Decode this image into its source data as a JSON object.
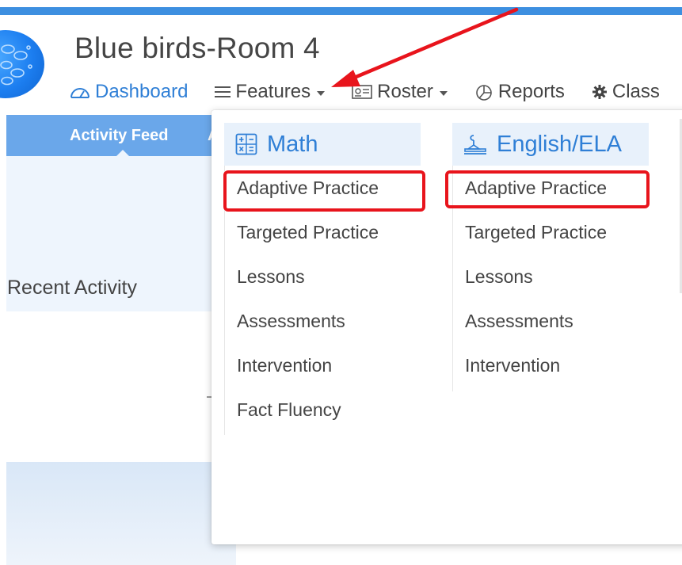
{
  "header": {
    "room_title": "Blue birds-Room 4"
  },
  "nav": {
    "items": [
      {
        "label": "Dashboard",
        "icon": "gauge-icon",
        "active": true
      },
      {
        "label": "Features",
        "icon": "menu-lines-icon",
        "caret": true
      },
      {
        "label": "Roster",
        "icon": "id-card-icon",
        "caret": true
      },
      {
        "label": "Reports",
        "icon": "pie-chart-icon"
      },
      {
        "label": "Class",
        "icon": "gear-icon"
      }
    ]
  },
  "subnav": {
    "active_tab": "Activity Feed",
    "partial_tab": "A"
  },
  "main": {
    "recent_activity": "Recent Activity"
  },
  "features_menu": {
    "math": {
      "title": "Math",
      "icon": "calculator-icon",
      "items": [
        "Adaptive Practice",
        "Targeted Practice",
        "Lessons",
        "Assessments",
        "Intervention",
        "Fact Fluency"
      ]
    },
    "ela": {
      "title": "English/ELA",
      "icon": "reading-lamp-icon",
      "items": [
        "Adaptive Practice",
        "Targeted Practice",
        "Lessons",
        "Assessments",
        "Intervention"
      ]
    }
  },
  "colors": {
    "accent": "#2f7fd6",
    "top_strip": "#3d8fe0",
    "annotation": "#e8141c"
  }
}
